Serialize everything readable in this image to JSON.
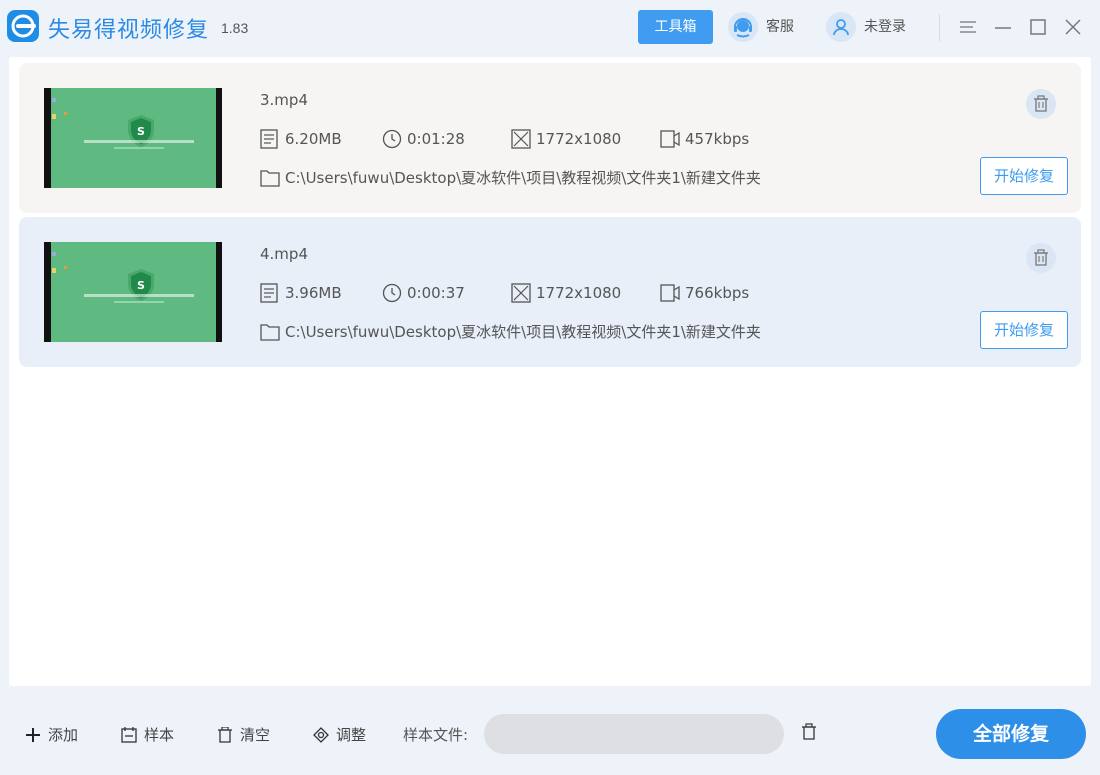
{
  "header": {
    "app_name": "失易得视频修复",
    "version": "1.83",
    "toolbox_label": "工具箱",
    "support_label": "客服",
    "login_label": "未登录"
  },
  "files": [
    {
      "name": "3.mp4",
      "size": "6.20MB",
      "duration": "0:01:28",
      "resolution": "1772x1080",
      "bitrate": "457kbps",
      "path": "C:\\Users\\fuwu\\Desktop\\夏冰软件\\项目\\教程视频\\文件夹1\\新建文件夹",
      "repair_label": "开始修复"
    },
    {
      "name": "4.mp4",
      "size": "3.96MB",
      "duration": "0:00:37",
      "resolution": "1772x1080",
      "bitrate": "766kbps",
      "path": "C:\\Users\\fuwu\\Desktop\\夏冰软件\\项目\\教程视频\\文件夹1\\新建文件夹",
      "repair_label": "开始修复"
    }
  ],
  "footer": {
    "add_label": "添加",
    "sample_label": "样本",
    "clear_label": "清空",
    "adjust_label": "调整",
    "sample_file_label": "样本文件:",
    "sample_file_value": "",
    "repair_all_label": "全部修复"
  },
  "colors": {
    "accent": "#3f9cf0",
    "primary_button": "#2e8fe8",
    "card_selected": "#e8eff9",
    "card_default": "#f6f5f3"
  },
  "icons": {
    "logo": "app-logo-icon",
    "support": "headset-icon",
    "user": "user-icon",
    "menu": "menu-icon",
    "minimize": "minimize-icon",
    "maximize": "maximize-icon",
    "close": "close-icon"
  }
}
